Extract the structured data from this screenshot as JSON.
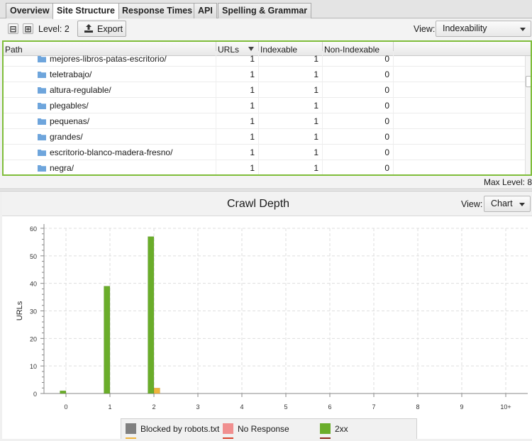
{
  "tabs": [
    {
      "label": "Overview",
      "active": false
    },
    {
      "label": "Site Structure",
      "active": true
    },
    {
      "label": "Response Times",
      "active": false
    },
    {
      "label": "API",
      "active": false
    },
    {
      "label": "Spelling & Grammar",
      "active": false
    }
  ],
  "toolbar": {
    "collapse_symbol": "⊟",
    "expand_symbol": "⊞",
    "level_label": "Level: 2",
    "export_label": "Export",
    "view_label": "View:",
    "view_value": "Indexability"
  },
  "table": {
    "columns": [
      "Path",
      "URLs",
      "Indexable",
      "Non-Indexable"
    ],
    "sorted_column": "URLs",
    "rows": [
      {
        "path": "mejores-libros-patas-escritorio/",
        "urls": "1",
        "indexable": "1",
        "non_indexable": "0"
      },
      {
        "path": "teletrabajo/",
        "urls": "1",
        "indexable": "1",
        "non_indexable": "0"
      },
      {
        "path": "altura-regulable/",
        "urls": "1",
        "indexable": "1",
        "non_indexable": "0"
      },
      {
        "path": "plegables/",
        "urls": "1",
        "indexable": "1",
        "non_indexable": "0"
      },
      {
        "path": "pequenas/",
        "urls": "1",
        "indexable": "1",
        "non_indexable": "0"
      },
      {
        "path": "grandes/",
        "urls": "1",
        "indexable": "1",
        "non_indexable": "0"
      },
      {
        "path": "escritorio-blanco-madera-fresno/",
        "urls": "1",
        "indexable": "1",
        "non_indexable": "0"
      },
      {
        "path": "negra/",
        "urls": "1",
        "indexable": "1",
        "non_indexable": "0"
      }
    ]
  },
  "status": {
    "max_level": "Max Level: 8"
  },
  "chart_panel": {
    "title": "Crawl Depth",
    "view_label": "View:",
    "view_value": "Chart"
  },
  "colors": {
    "accent_border": "#7fbd3a",
    "folder_icon": "#6ea5dc",
    "blocked": "#808080",
    "no_response": "#f08f8f",
    "ok_2xx": "#6aad2a",
    "redirect_3xx": "#f0b43c",
    "client_error_4xx": "#d9442c",
    "server_error_5xx": "#8c2a1c"
  },
  "chart_data": {
    "type": "bar",
    "title": "Crawl Depth",
    "xlabel": "",
    "ylabel": "URLs",
    "categories": [
      "0",
      "1",
      "2",
      "3",
      "4",
      "5",
      "6",
      "7",
      "8",
      "9",
      "10+"
    ],
    "ylim": [
      0,
      60
    ],
    "yticks": [
      0,
      10,
      20,
      30,
      40,
      50,
      60
    ],
    "grid": true,
    "legend_position": "bottom",
    "series": [
      {
        "name": "Blocked by robots.txt",
        "color": "#808080",
        "values": [
          0,
          0,
          0,
          0,
          0,
          0,
          0,
          0,
          0,
          0,
          0
        ]
      },
      {
        "name": "No Response",
        "color": "#f08f8f",
        "values": [
          0,
          0,
          0,
          0,
          0,
          0,
          0,
          0,
          0,
          0,
          0
        ]
      },
      {
        "name": "2xx",
        "color": "#6aad2a",
        "values": [
          1,
          39,
          57,
          0,
          0,
          0,
          0,
          0,
          0,
          0,
          0
        ]
      },
      {
        "color": "#f0b43c",
        "values": [
          0,
          0,
          2,
          0,
          0,
          0,
          0,
          0,
          0,
          0,
          0
        ]
      },
      {
        "color": "#d9442c",
        "values": [
          0,
          0,
          0,
          0,
          0,
          0,
          0,
          0,
          0,
          0,
          0
        ]
      },
      {
        "color": "#8c2a1c",
        "values": [
          0,
          0,
          0,
          0,
          0,
          0,
          0,
          0,
          0,
          0,
          0
        ]
      }
    ]
  }
}
